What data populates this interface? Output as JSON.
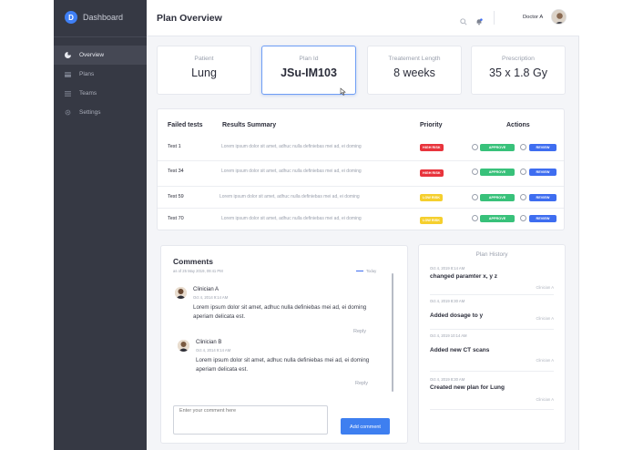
{
  "brand": {
    "logo_letter": "D",
    "title": "Dashboard"
  },
  "sidebar": {
    "items": [
      {
        "label": "Overview",
        "icon": "pie-chart-icon",
        "active": true
      },
      {
        "label": "Plans",
        "icon": "card-icon",
        "active": false
      },
      {
        "label": "Teams",
        "icon": "list-icon",
        "active": false
      },
      {
        "label": "Settings",
        "icon": "gear-icon",
        "active": false
      }
    ]
  },
  "header": {
    "title": "Plan Overview",
    "user_name": "Doctor A"
  },
  "stats": [
    {
      "label": "Patient",
      "value": "Lung"
    },
    {
      "label": "Plan Id",
      "value": "JSu-IM103"
    },
    {
      "label": "Treatement Length",
      "value": "8 weeks"
    },
    {
      "label": "Prescription",
      "value": "35 x 1.8 Gy"
    }
  ],
  "table": {
    "headers": {
      "tests": "Failed tests",
      "summary": "Results Summary",
      "priority": "Priority",
      "actions": "Actions"
    },
    "approve_label": "APPROVE",
    "review_label": "REVIEW",
    "rows": [
      {
        "test": "Test 1",
        "summary": "Lorem ipsum dolor sit amet, adhuc nulla definiebas mei ad, ei doming",
        "priority": "HIGH RISK",
        "priority_color": "#e8343c"
      },
      {
        "test": "Test 34",
        "summary": "Lorem ipsum dolor sit amet, adhuc nulla definiebas mei ad, ei doming",
        "priority": "HIGH RISK",
        "priority_color": "#e8343c"
      },
      {
        "test": "Test 59",
        "summary": "Lorem ipsum dolor sit amet, adhuc nulla definiebas mei ad, ei doming",
        "priority": "LOW RISK",
        "priority_color": "#f5cf2e"
      },
      {
        "test": "Test 70",
        "summary": "Lorem ipsum dolor sit amet, adhuc nulla definiebas mei ad, ei doming",
        "priority": "LOW RISK",
        "priority_color": "#f5cf2e"
      }
    ]
  },
  "comments": {
    "title": "Comments",
    "subtitle": "as of 25 May 2019, 09:41 PM",
    "today_label": "Today",
    "items": [
      {
        "author": "Clinician A",
        "date": "Oct 4, 2014 9:14 AM",
        "text": "Lorem ipsum dolor sit amet, adhuc nulla definiebas mei ad, ei doming aperiam delicata est.",
        "reply": "Reply"
      },
      {
        "author": "Clinician B",
        "date": "Oct 4, 2014 9:14 AM",
        "text": "Lorem ipsum dolor sit amet, adhuc nulla definiebas mei ad, ei doming aperiam delicata est.",
        "reply": "Reply"
      }
    ],
    "input_placeholder": "Enter your comment here",
    "add_button": "Add comment"
  },
  "history": {
    "title": "Plan History",
    "items": [
      {
        "date": "Oct 4, 2019 8:14 AM",
        "text": "changed paramter x, y z",
        "by": "Clinician A"
      },
      {
        "date": "Oct 4, 2019 8:30 AM",
        "text": "Added dosage to y",
        "by": "Clinician A"
      },
      {
        "date": "Oct 4, 2019 10:14 AM",
        "text": "Added new CT scans",
        "by": "Clinician A"
      },
      {
        "date": "Oct 4, 2019 8:30 AM",
        "text": "Created new plan for Lung",
        "by": "Clinician A"
      }
    ]
  },
  "colors": {
    "sidebar_bg": "#363944",
    "accent": "#3e6df0",
    "approve": "#38c17a",
    "high_risk": "#e8343c",
    "low_risk": "#f5cf2e"
  }
}
